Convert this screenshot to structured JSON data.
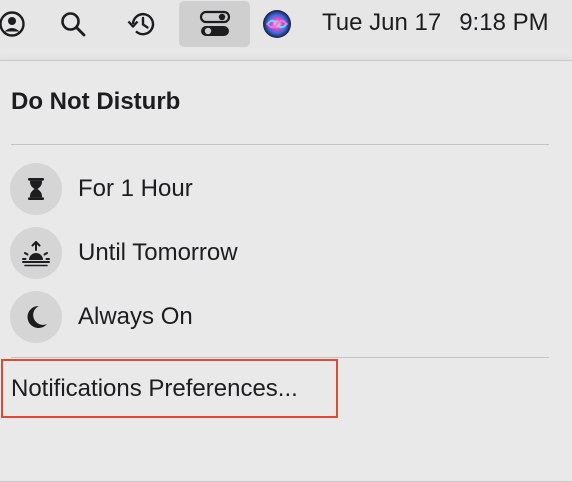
{
  "menubar": {
    "icons": [
      "user-account-icon",
      "spotlight-search-icon",
      "time-machine-icon",
      "control-center-icon",
      "siri-icon"
    ],
    "date": "Tue Jun 17",
    "time": "9:18 PM"
  },
  "dnd_panel": {
    "title": "Do Not Disturb",
    "options": [
      {
        "label": "For 1 Hour",
        "icon": "hourglass-icon"
      },
      {
        "label": "Until Tomorrow",
        "icon": "sunrise-icon"
      },
      {
        "label": "Always On",
        "icon": "moon-icon"
      }
    ],
    "preferences_label": "Notifications Preferences..."
  },
  "colors": {
    "highlight_border": "#e04a35",
    "menubar_bg": "#e6e6e6",
    "active_item_bg": "#cfcfcf"
  }
}
